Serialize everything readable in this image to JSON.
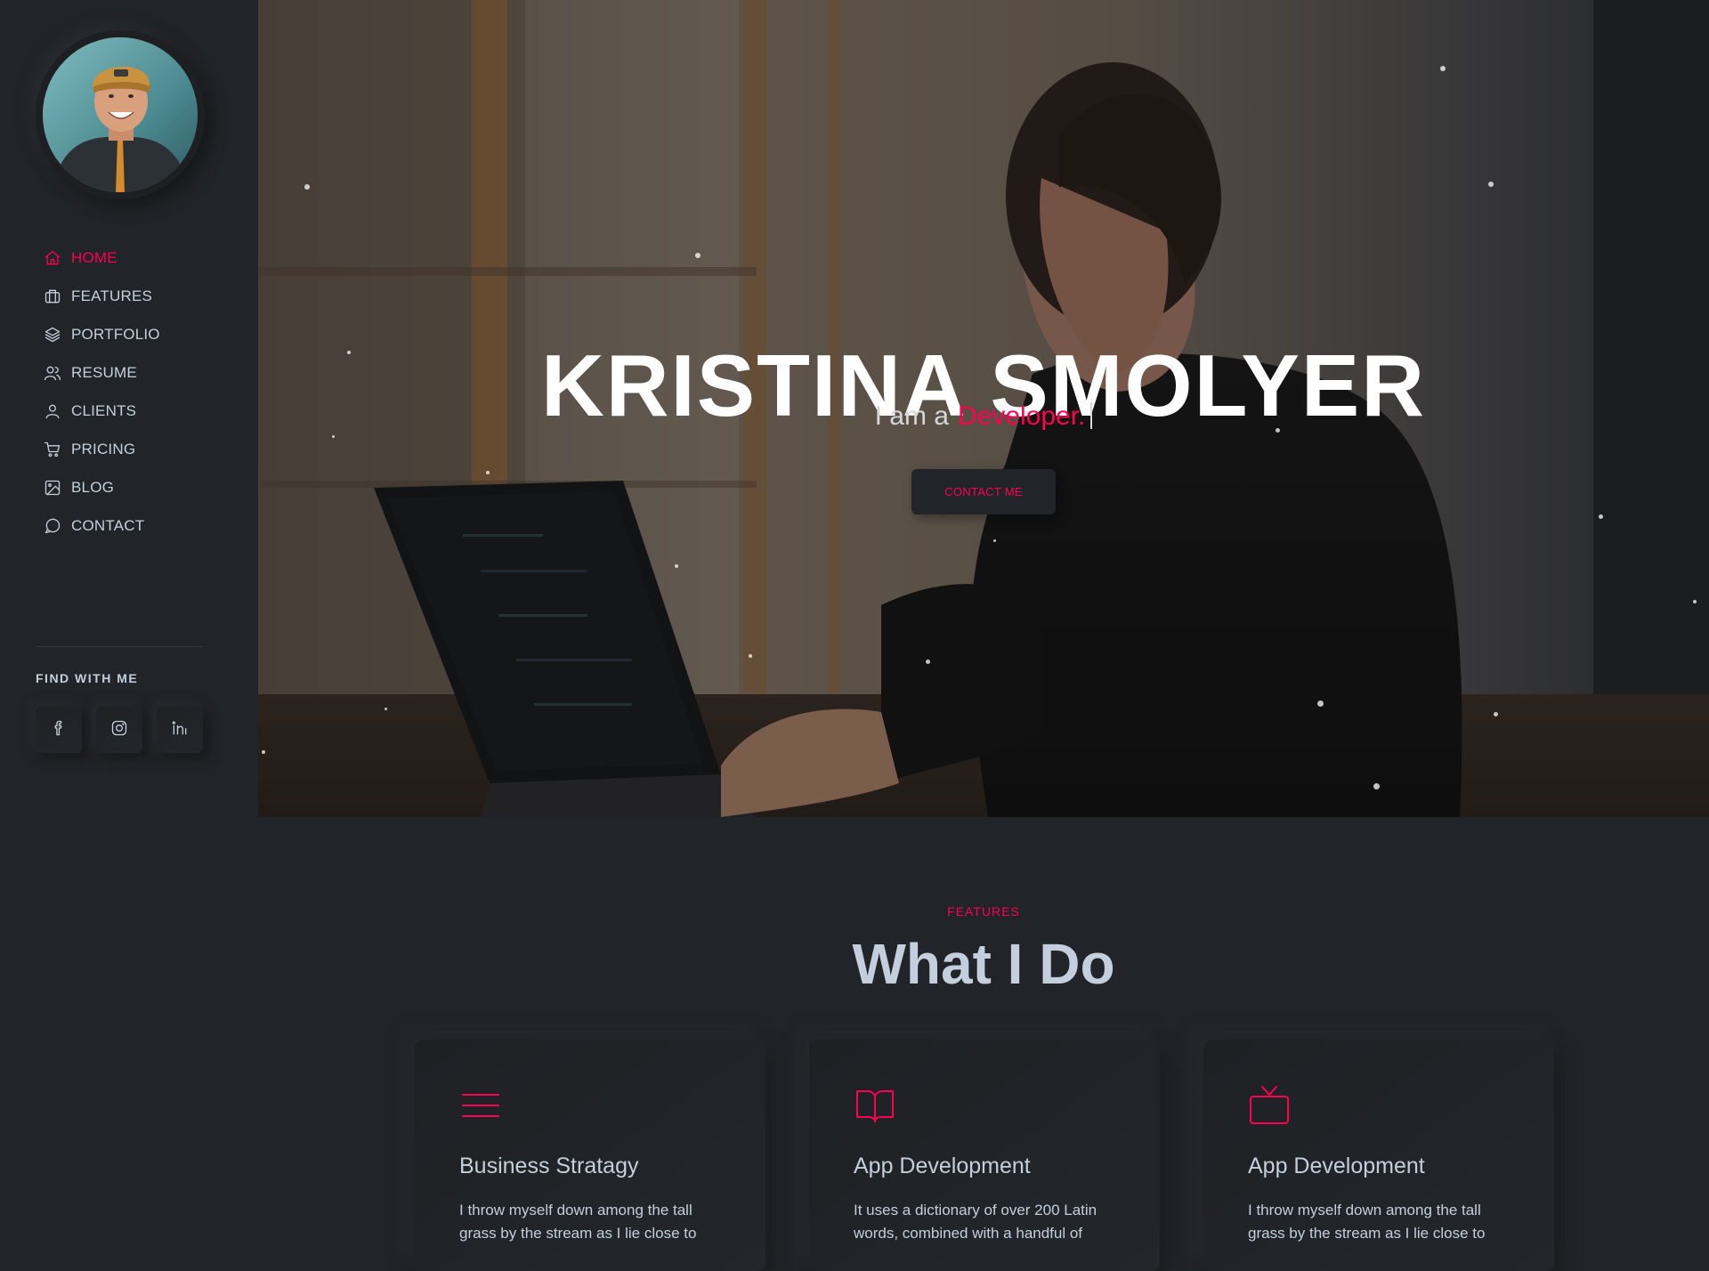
{
  "sidebar": {
    "nav": [
      {
        "label": "HOME",
        "icon": "home-icon",
        "active": true
      },
      {
        "label": "FEATURES",
        "icon": "briefcase-icon",
        "active": false
      },
      {
        "label": "PORTFOLIO",
        "icon": "layers-icon",
        "active": false
      },
      {
        "label": "RESUME",
        "icon": "users-icon",
        "active": false
      },
      {
        "label": "CLIENTS",
        "icon": "user-icon",
        "active": false
      },
      {
        "label": "PRICING",
        "icon": "cart-icon",
        "active": false
      },
      {
        "label": "BLOG",
        "icon": "image-icon",
        "active": false
      },
      {
        "label": "CONTACT",
        "icon": "message-icon",
        "active": false
      }
    ],
    "find_title": "FIND WITH ME",
    "social": [
      "facebook-icon",
      "instagram-icon",
      "linkedin-icon"
    ]
  },
  "hero": {
    "title": "KRISTINA SMOLYER",
    "subtitle_prefix": "I am a",
    "subtitle_role": "Developer.",
    "button_label": "CONTACT ME"
  },
  "features": {
    "subtitle": "FEATURES",
    "title": "What I Do",
    "cards": [
      {
        "icon": "menu-icon",
        "title": "Business Stratagy",
        "text": "I throw myself down among the tall grass by the stream as I lie close to"
      },
      {
        "icon": "book-icon",
        "title": "App Development",
        "text": "It uses a dictionary of over 200 Latin words, combined with a handful of"
      },
      {
        "icon": "tv-icon",
        "title": "App Development",
        "text": "I throw myself down among the tall grass by the stream as I lie close to"
      }
    ]
  },
  "colors": {
    "accent": "#ff014f",
    "background": "#212428",
    "text": "#c4cfde"
  }
}
